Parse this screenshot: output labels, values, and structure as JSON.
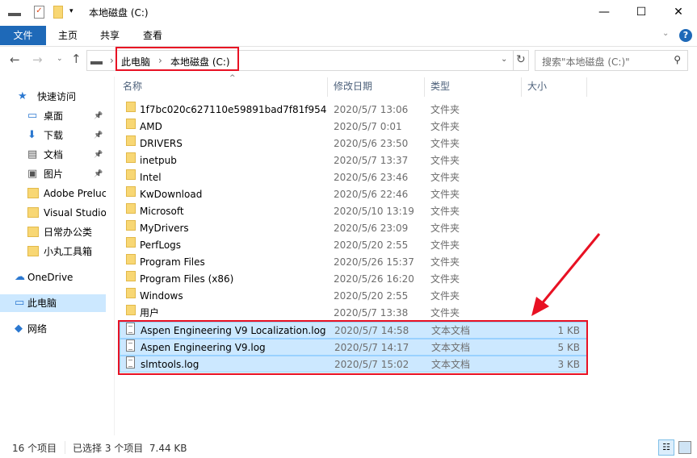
{
  "window": {
    "title": "本地磁盘 (C:)",
    "minimize": "—",
    "maximize": "☐",
    "close": "✕"
  },
  "ribbon": {
    "tabs": [
      "文件",
      "主页",
      "共享",
      "查看"
    ],
    "help": "?"
  },
  "address": {
    "crumbs": [
      "此电脑",
      "本地磁盘 (C:)"
    ],
    "search_placeholder": "搜索\"本地磁盘 (C:)\""
  },
  "columns": [
    "名称",
    "修改日期",
    "类型",
    "大小"
  ],
  "sidebar": [
    {
      "label": "快速访问",
      "icon": "star-icon"
    },
    {
      "label": "桌面",
      "icon": "desktop-icon",
      "pin": true
    },
    {
      "label": "下载",
      "icon": "download-icon",
      "pin": true
    },
    {
      "label": "文档",
      "icon": "document-icon",
      "pin": true
    },
    {
      "label": "图片",
      "icon": "pictures-icon",
      "pin": true
    },
    {
      "label": "Adobe Preluc",
      "icon": "folder-icon"
    },
    {
      "label": "Visual Studio",
      "icon": "folder-icon"
    },
    {
      "label": "日常办公类",
      "icon": "folder-icon"
    },
    {
      "label": "小丸工具箱",
      "icon": "folder-icon"
    },
    {
      "label": "OneDrive",
      "icon": "cloud-icon"
    },
    {
      "label": "此电脑",
      "icon": "computer-icon",
      "selected": true
    },
    {
      "label": "网络",
      "icon": "network-icon"
    }
  ],
  "files": [
    {
      "name": "1f7bc020c627110e59891bad7f81f954",
      "date": "2020/5/7 13:06",
      "type": "文件夹",
      "size": ""
    },
    {
      "name": "AMD",
      "date": "2020/5/7 0:01",
      "type": "文件夹",
      "size": ""
    },
    {
      "name": "DRIVERS",
      "date": "2020/5/6 23:50",
      "type": "文件夹",
      "size": ""
    },
    {
      "name": "inetpub",
      "date": "2020/5/7 13:37",
      "type": "文件夹",
      "size": ""
    },
    {
      "name": "Intel",
      "date": "2020/5/6 23:46",
      "type": "文件夹",
      "size": ""
    },
    {
      "name": "KwDownload",
      "date": "2020/5/6 22:46",
      "type": "文件夹",
      "size": ""
    },
    {
      "name": "Microsoft",
      "date": "2020/5/10 13:19",
      "type": "文件夹",
      "size": ""
    },
    {
      "name": "MyDrivers",
      "date": "2020/5/6 23:09",
      "type": "文件夹",
      "size": ""
    },
    {
      "name": "PerfLogs",
      "date": "2020/5/20 2:55",
      "type": "文件夹",
      "size": ""
    },
    {
      "name": "Program Files",
      "date": "2020/5/26 15:37",
      "type": "文件夹",
      "size": ""
    },
    {
      "name": "Program Files (x86)",
      "date": "2020/5/26 16:20",
      "type": "文件夹",
      "size": ""
    },
    {
      "name": "Windows",
      "date": "2020/5/20 2:55",
      "type": "文件夹",
      "size": ""
    },
    {
      "name": "用户",
      "date": "2020/5/7 13:38",
      "type": "文件夹",
      "size": ""
    },
    {
      "name": "Aspen Engineering V9 Localization.log",
      "date": "2020/5/7 14:58",
      "type": "文本文档",
      "size": "1 KB",
      "selected": true
    },
    {
      "name": "Aspen Engineering V9.log",
      "date": "2020/5/7 14:17",
      "type": "文本文档",
      "size": "5 KB",
      "selected": true
    },
    {
      "name": "slmtools.log",
      "date": "2020/5/7 15:02",
      "type": "文本文档",
      "size": "3 KB",
      "selected": true
    }
  ],
  "status": {
    "count": "16 个项目",
    "selection": "已选择 3 个项目  7.44 KB"
  },
  "colors": {
    "accent": "#1e69b8",
    "selection": "#cce8ff",
    "highlight": "#e81123"
  }
}
